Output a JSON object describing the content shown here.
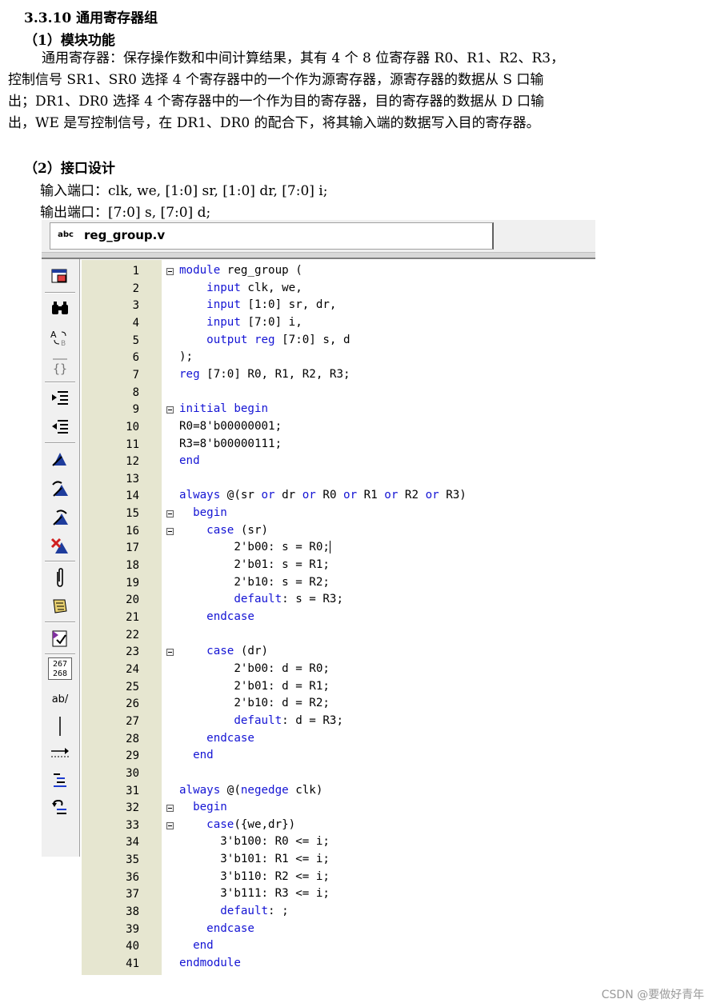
{
  "document": {
    "section_title": "3.3.10  通用寄存器组",
    "sub1_title": "（1）模块功能",
    "para1": [
      "通用寄存器：保存操作数和中间计算结果，其有 4 个 8 位寄存器 R0、R1、R2、R3，",
      "控制信号 SR1、SR0 选择 4 个寄存器中的一个作为源寄存器，源寄存器的数据从 S 口输",
      "出；DR1、DR0 选择 4 个寄存器中的一个作为目的寄存器，目的寄存器的数据从 D 口输",
      "出，WE 是写控制信号，在 DR1、DR0 的配合下，将其输入端的数据写入目的寄存器。"
    ],
    "sub2_title": "（2）接口设计",
    "input_ports": "输入端口：clk, we, [1:0] sr, [1:0] dr, [7:0] i;",
    "output_ports": "输出端口：[7:0] s, [7:0] d;"
  },
  "editor": {
    "tab_icon_label": "abc",
    "tab_title": "reg_group.v",
    "toolbar_icons": [
      "insert-file-icon",
      "find-binoculars-icon",
      "find-replace-icon",
      "braces-icon",
      "indent-icon",
      "unindent-icon",
      "bookmark-icon",
      "next-bookmark-icon",
      "previous-bookmark-icon",
      "clear-bookmarks-icon",
      "paperclip-icon",
      "scroll-icon",
      "check-file-icon",
      "line-number-icon",
      "spell-icon",
      "vertical-bar-icon",
      "arrow-right-icon",
      "align-list-icon",
      "undo-list-icon"
    ],
    "line_number_icon_text": [
      "267",
      "268"
    ],
    "spell_icon_text": "ab/",
    "lines": [
      {
        "n": "1",
        "fold": true,
        "parts": [
          [
            "k",
            "module"
          ],
          [
            "t",
            " reg_group ("
          ]
        ]
      },
      {
        "n": "2",
        "fold": false,
        "parts": [
          [
            "t",
            "    "
          ],
          [
            "k",
            "input"
          ],
          [
            "t",
            " clk, we,"
          ]
        ]
      },
      {
        "n": "3",
        "fold": false,
        "parts": [
          [
            "t",
            "    "
          ],
          [
            "k",
            "input"
          ],
          [
            "t",
            " [1:0] sr, dr,"
          ]
        ]
      },
      {
        "n": "4",
        "fold": false,
        "parts": [
          [
            "t",
            "    "
          ],
          [
            "k",
            "input"
          ],
          [
            "t",
            " [7:0] i,"
          ]
        ]
      },
      {
        "n": "5",
        "fold": false,
        "parts": [
          [
            "t",
            "    "
          ],
          [
            "k",
            "output"
          ],
          [
            "t",
            " "
          ],
          [
            "k",
            "reg"
          ],
          [
            "t",
            " [7:0] s, d"
          ]
        ]
      },
      {
        "n": "6",
        "fold": false,
        "parts": [
          [
            "t",
            ");"
          ]
        ]
      },
      {
        "n": "7",
        "fold": false,
        "parts": [
          [
            "k",
            "reg"
          ],
          [
            "t",
            " [7:0] R0, R1, R2, R3;"
          ]
        ]
      },
      {
        "n": "8",
        "fold": false,
        "parts": []
      },
      {
        "n": "9",
        "fold": true,
        "parts": [
          [
            "k",
            "initial"
          ],
          [
            "t",
            " "
          ],
          [
            "k",
            "begin"
          ]
        ]
      },
      {
        "n": "10",
        "fold": false,
        "parts": [
          [
            "t",
            "R0=8'b00000001;"
          ]
        ]
      },
      {
        "n": "11",
        "fold": false,
        "parts": [
          [
            "t",
            "R3=8'b00000111;"
          ]
        ]
      },
      {
        "n": "12",
        "fold": false,
        "parts": [
          [
            "k",
            "end"
          ]
        ]
      },
      {
        "n": "13",
        "fold": false,
        "parts": []
      },
      {
        "n": "14",
        "fold": false,
        "parts": [
          [
            "k",
            "always"
          ],
          [
            "t",
            " @(sr "
          ],
          [
            "k",
            "or"
          ],
          [
            "t",
            " dr "
          ],
          [
            "k",
            "or"
          ],
          [
            "t",
            " R0 "
          ],
          [
            "k",
            "or"
          ],
          [
            "t",
            " R1 "
          ],
          [
            "k",
            "or"
          ],
          [
            "t",
            " R2 "
          ],
          [
            "k",
            "or"
          ],
          [
            "t",
            " R3)"
          ]
        ]
      },
      {
        "n": "15",
        "fold": true,
        "parts": [
          [
            "t",
            "  "
          ],
          [
            "k",
            "begin"
          ]
        ]
      },
      {
        "n": "16",
        "fold": true,
        "parts": [
          [
            "t",
            "    "
          ],
          [
            "k",
            "case"
          ],
          [
            "t",
            " (sr)"
          ]
        ]
      },
      {
        "n": "17",
        "fold": false,
        "cursor": true,
        "parts": [
          [
            "t",
            "        2'b00: s = R0;"
          ]
        ]
      },
      {
        "n": "18",
        "fold": false,
        "parts": [
          [
            "t",
            "        2'b01: s = R1;"
          ]
        ]
      },
      {
        "n": "19",
        "fold": false,
        "parts": [
          [
            "t",
            "        2'b10: s = R2;"
          ]
        ]
      },
      {
        "n": "20",
        "fold": false,
        "parts": [
          [
            "t",
            "        "
          ],
          [
            "k",
            "default"
          ],
          [
            "t",
            ": s = R3;"
          ]
        ]
      },
      {
        "n": "21",
        "fold": false,
        "parts": [
          [
            "t",
            "    "
          ],
          [
            "k",
            "endcase"
          ]
        ]
      },
      {
        "n": "22",
        "fold": false,
        "parts": []
      },
      {
        "n": "23",
        "fold": true,
        "parts": [
          [
            "t",
            "    "
          ],
          [
            "k",
            "case"
          ],
          [
            "t",
            " (dr)"
          ]
        ]
      },
      {
        "n": "24",
        "fold": false,
        "parts": [
          [
            "t",
            "        2'b00: d = R0;"
          ]
        ]
      },
      {
        "n": "25",
        "fold": false,
        "parts": [
          [
            "t",
            "        2'b01: d = R1;"
          ]
        ]
      },
      {
        "n": "26",
        "fold": false,
        "parts": [
          [
            "t",
            "        2'b10: d = R2;"
          ]
        ]
      },
      {
        "n": "27",
        "fold": false,
        "parts": [
          [
            "t",
            "        "
          ],
          [
            "k",
            "default"
          ],
          [
            "t",
            ": d = R3;"
          ]
        ]
      },
      {
        "n": "28",
        "fold": false,
        "parts": [
          [
            "t",
            "    "
          ],
          [
            "k",
            "endcase"
          ]
        ]
      },
      {
        "n": "29",
        "fold": false,
        "parts": [
          [
            "t",
            "  "
          ],
          [
            "k",
            "end"
          ]
        ]
      },
      {
        "n": "30",
        "fold": false,
        "parts": []
      },
      {
        "n": "31",
        "fold": false,
        "parts": [
          [
            "k",
            "always"
          ],
          [
            "t",
            " @("
          ],
          [
            "k",
            "negedge"
          ],
          [
            "t",
            " clk)"
          ]
        ]
      },
      {
        "n": "32",
        "fold": true,
        "parts": [
          [
            "t",
            "  "
          ],
          [
            "k",
            "begin"
          ]
        ]
      },
      {
        "n": "33",
        "fold": true,
        "parts": [
          [
            "t",
            "    "
          ],
          [
            "k",
            "case"
          ],
          [
            "t",
            "({we,dr})"
          ]
        ]
      },
      {
        "n": "34",
        "fold": false,
        "parts": [
          [
            "t",
            "      3'b100: R0 <= i;"
          ]
        ]
      },
      {
        "n": "35",
        "fold": false,
        "parts": [
          [
            "t",
            "      3'b101: R1 <= i;"
          ]
        ]
      },
      {
        "n": "36",
        "fold": false,
        "parts": [
          [
            "t",
            "      3'b110: R2 <= i;"
          ]
        ]
      },
      {
        "n": "37",
        "fold": false,
        "parts": [
          [
            "t",
            "      3'b111: R3 <= i;"
          ]
        ]
      },
      {
        "n": "38",
        "fold": false,
        "parts": [
          [
            "t",
            "      "
          ],
          [
            "k",
            "default"
          ],
          [
            "t",
            ": ;"
          ]
        ]
      },
      {
        "n": "39",
        "fold": false,
        "parts": [
          [
            "t",
            "    "
          ],
          [
            "k",
            "endcase"
          ]
        ]
      },
      {
        "n": "40",
        "fold": false,
        "parts": [
          [
            "t",
            "  "
          ],
          [
            "k",
            "end"
          ]
        ]
      },
      {
        "n": "41",
        "fold": false,
        "parts": [
          [
            "k",
            "endmodule"
          ]
        ]
      }
    ]
  },
  "watermark": "CSDN @要做好青年",
  "colors": {
    "keyword": "#1414d4",
    "gutter": "#e6e6d0"
  }
}
